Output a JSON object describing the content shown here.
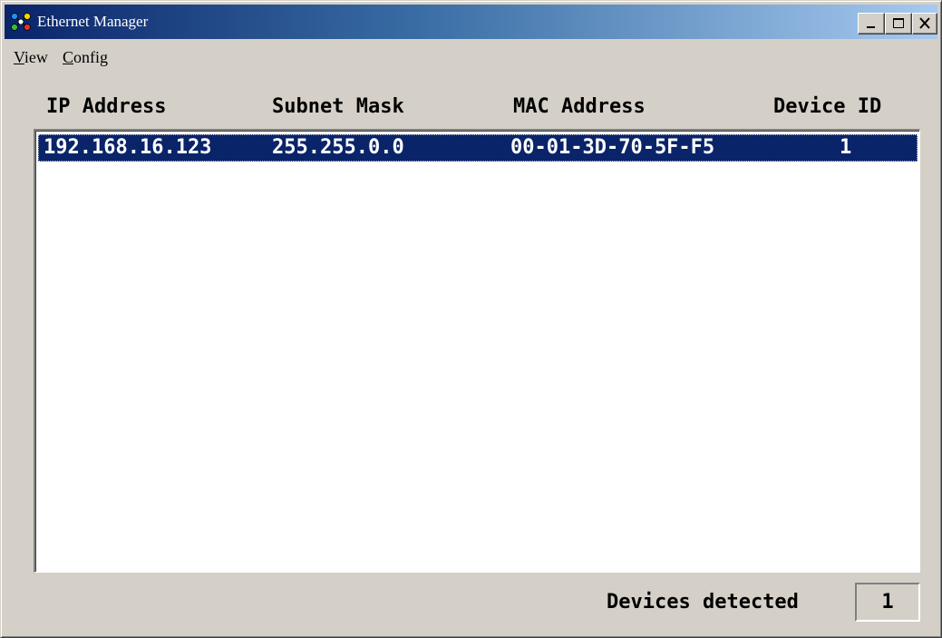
{
  "window": {
    "title": "Ethernet Manager",
    "icon": "network-app-icon"
  },
  "menu": {
    "view": {
      "mnemonic": "V",
      "rest": "iew"
    },
    "config": {
      "mnemonic": "C",
      "rest": "onfig"
    }
  },
  "table": {
    "columns": [
      "IP Address",
      "Subnet Mask",
      "MAC Address",
      "Device ID"
    ],
    "rows": [
      {
        "ip": "192.168.16.123",
        "subnet": "255.255.0.0",
        "mac": "00-01-3D-70-5F-F5",
        "device_id": "1",
        "selected": true
      }
    ]
  },
  "status": {
    "label": "Devices detected",
    "count": "1"
  },
  "colors": {
    "selection": "#0a246a",
    "face": "#d4d0c8"
  }
}
